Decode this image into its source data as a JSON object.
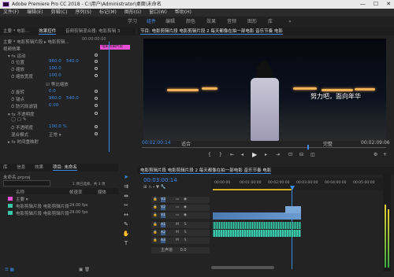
{
  "window": {
    "title": "Adobe Premiere Pro CC 2018 - C:\\用户\\Administrator\\桌面\\未命名",
    "min": "—",
    "max": "☐",
    "close": "✕"
  },
  "menu": [
    "文件(F)",
    "编辑(E)",
    "剪辑(C)",
    "序列(S)",
    "标记(M)",
    "图形(G)",
    "窗口(W)",
    "帮助(H)"
  ],
  "workspaces": [
    {
      "label": "学习",
      "active": false
    },
    {
      "label": "组件",
      "active": true
    },
    {
      "label": "编辑",
      "active": false
    },
    {
      "label": "颜色",
      "active": false
    },
    {
      "label": "效果",
      "active": false
    },
    {
      "label": "音频",
      "active": false
    },
    {
      "label": "图形",
      "active": false
    },
    {
      "label": "库",
      "active": false
    }
  ],
  "effect_controls": {
    "tabs": [
      "主要 * 电影...",
      "效果控件",
      "音频剪辑混合器: 电影剪辑 3",
      "元数据"
    ],
    "clip_header": "主要 * 电影剪辑片段 ▸ 电影剪辑...",
    "video_effects_label": "视频效果",
    "motion": "运动",
    "position": {
      "label": "位置",
      "x": "960.0",
      "y": "540.0"
    },
    "scale": {
      "label": "缩放",
      "value": "100.0"
    },
    "scale_width": {
      "label": "缩放宽度",
      "value": "100.0"
    },
    "uniform_scale": "等比缩放",
    "rotation": {
      "label": "旋转",
      "value": "0.0"
    },
    "anchor": {
      "label": "锚点",
      "x": "960.0",
      "y": "540.0"
    },
    "anti_flicker": {
      "label": "防闪烁滤镜",
      "value": "0.00"
    },
    "opacity_section": "不透明度",
    "opacity": {
      "label": "不透明度",
      "value": "100.0 %"
    },
    "blend_mode": {
      "label": "混合模式",
      "value": "正常"
    },
    "time_remap": "时间重映射",
    "ruler_time": "00:00:00:00",
    "clip_tag": "电影剪辑片段"
  },
  "program": {
    "header": "节目: 电影剪辑片段 电影剪辑片段 2 每天都像在拍一部电影 音乐节奏 电影",
    "subtitle": "努力吧，面向年华",
    "timecode": "00:02:00:14",
    "fit": "适合",
    "quality": "完整",
    "duration": "00:02:09:06"
  },
  "project": {
    "tabs": [
      "项目",
      "媒体浏览器",
      "库",
      "信息",
      "效果",
      "标记",
      "历史记录"
    ],
    "active_tab": "项目: 未命名",
    "filename": "未命名.prproj",
    "count": "1 项已选择，共 3 项",
    "col_name": "名称",
    "col_rate": "帧速率",
    "col_media": "媒体",
    "items": [
      {
        "name": "主要 ▾",
        "rate": "",
        "color": "#e84fd4"
      },
      {
        "name": "电影剪辑片段 电影剪辑片段",
        "rate": "24.00 fps",
        "color": "#3ac8a8"
      },
      {
        "name": "电影剪辑片段 电影剪辑片段",
        "rate": "24.00 fps",
        "color": "#3ac8a8"
      }
    ]
  },
  "timeline": {
    "header": "电影剪辑片段 电影剪辑片段 2 每天都像在拍一部电影 音乐节奏 电影",
    "timecode": "00:03:00:14",
    "ruler": [
      "00:00:00",
      "00:01:00:00",
      "00:02:00:00",
      "00:03:00:00",
      "00:04:00:00",
      "00:05:00:00"
    ],
    "tracks": [
      {
        "name": "V3",
        "kind": "video"
      },
      {
        "name": "V2",
        "kind": "video"
      },
      {
        "name": "V1",
        "kind": "video"
      },
      {
        "name": "A1",
        "kind": "audio"
      },
      {
        "name": "A2",
        "kind": "audio"
      },
      {
        "name": "A3",
        "kind": "audio"
      }
    ],
    "master": {
      "label": "主声道",
      "value": "0.0"
    }
  },
  "colors": {
    "accent": "#3b8ce8",
    "clip_tag": "#e84fd4",
    "audio_clip": "#3ac8a8"
  }
}
